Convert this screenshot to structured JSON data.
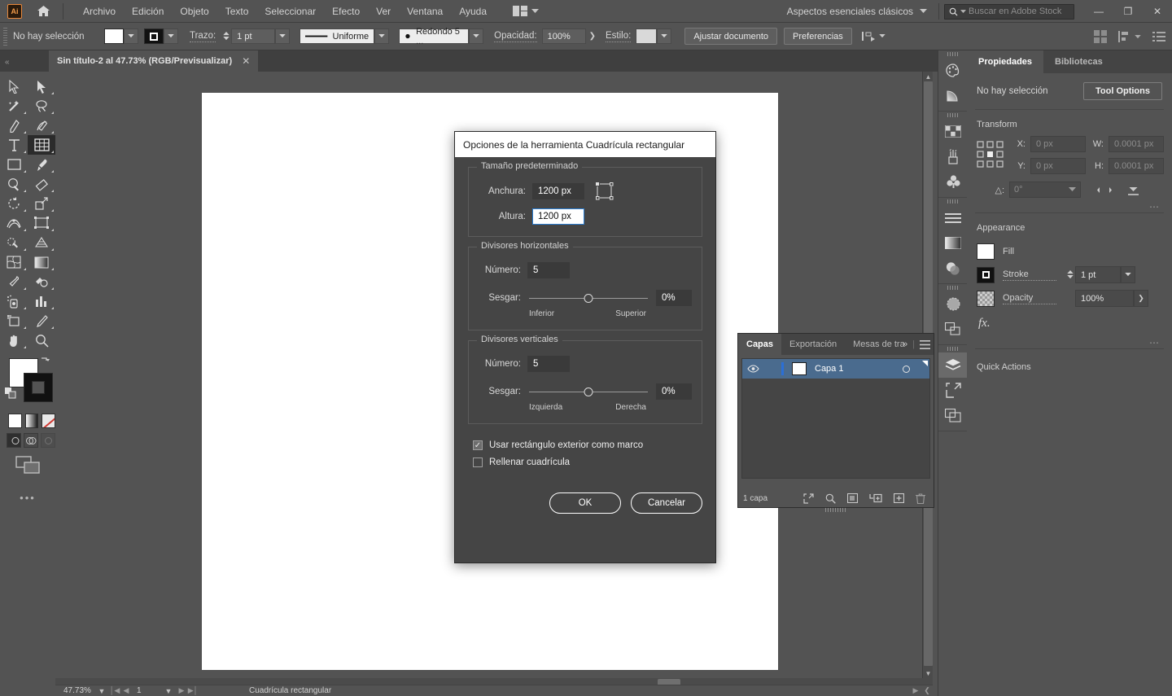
{
  "menubar": {
    "logo": "Ai",
    "home_icon": "home-icon",
    "items": [
      "Archivo",
      "Edición",
      "Objeto",
      "Texto",
      "Seleccionar",
      "Efecto",
      "Ver",
      "Ventana",
      "Ayuda"
    ],
    "arrange_icon": "arrange-documents-icon",
    "workspace": "Aspectos esenciales clásicos",
    "search_placeholder": "Buscar en Adobe Stock",
    "search_icon": "search-icon",
    "minimize": "—",
    "restore": "❐",
    "close": "✕"
  },
  "controlbar": {
    "selection_status": "No hay selección",
    "fill_label": "fill-swatch",
    "stroke_color_label": "stroke-swatch",
    "stroke_label": "Trazo:",
    "stroke_weight": "1 pt",
    "profile_label": "Uniforme",
    "brush_label": "Redondo 5 ...",
    "opacity_label": "Opacidad:",
    "opacity_value": "100%",
    "style_label": "Estilo:",
    "doc_setup_button": "Ajustar documento",
    "preferences_button": "Preferencias",
    "align_icon": "align-to-selection-icon"
  },
  "tabbar": {
    "document_title": "Sin título-2 al 47.73% (RGB/Previsualizar)",
    "close_icon": "✕"
  },
  "toolbar": {
    "tools": [
      {
        "name": "selection-tool",
        "glyph": "selection"
      },
      {
        "name": "direct-selection-tool",
        "glyph": "direct-selection"
      },
      {
        "name": "magic-wand-tool",
        "glyph": "wand"
      },
      {
        "name": "lasso-tool",
        "glyph": "lasso"
      },
      {
        "name": "pen-tool",
        "glyph": "pen"
      },
      {
        "name": "curvature-tool",
        "glyph": "curvature"
      },
      {
        "name": "type-tool",
        "glyph": "type"
      },
      {
        "name": "rectangular-grid-tool",
        "glyph": "grid",
        "active": true
      },
      {
        "name": "rectangle-tool",
        "glyph": "rect"
      },
      {
        "name": "paintbrush-tool",
        "glyph": "brush"
      },
      {
        "name": "shaper-tool",
        "glyph": "shaper"
      },
      {
        "name": "eraser-tool",
        "glyph": "eraser"
      },
      {
        "name": "rotate-tool",
        "glyph": "rotate"
      },
      {
        "name": "scale-tool",
        "glyph": "scale"
      },
      {
        "name": "width-tool",
        "glyph": "width"
      },
      {
        "name": "free-transform-tool",
        "glyph": "freetransform"
      },
      {
        "name": "shape-builder-tool",
        "glyph": "shapebuilder"
      },
      {
        "name": "perspective-grid-tool",
        "glyph": "perspective"
      },
      {
        "name": "mesh-tool",
        "glyph": "mesh"
      },
      {
        "name": "gradient-tool",
        "glyph": "gradient"
      },
      {
        "name": "eyedropper-tool",
        "glyph": "eyedropper"
      },
      {
        "name": "blend-tool",
        "glyph": "blend"
      },
      {
        "name": "symbol-sprayer-tool",
        "glyph": "symbolsprayer"
      },
      {
        "name": "column-graph-tool",
        "glyph": "graph"
      },
      {
        "name": "artboard-tool",
        "glyph": "artboard"
      },
      {
        "name": "slice-tool",
        "glyph": "slice"
      },
      {
        "name": "hand-tool",
        "glyph": "hand"
      },
      {
        "name": "zoom-tool",
        "glyph": "zoom"
      }
    ],
    "fill_color": "#ffffff",
    "stroke_color": "#000000",
    "swap_icon": "swap-fill-stroke-icon",
    "default_icon": "default-fill-stroke-icon",
    "modes": [
      "color-mode",
      "gradient-mode",
      "none-mode"
    ],
    "draw_modes": [
      "draw-normal",
      "draw-behind",
      "draw-inside"
    ],
    "screen_mode_icon": "change-screen-mode-icon",
    "more_dots": "•••"
  },
  "statusbar": {
    "zoom": "47.73%",
    "page": "1",
    "current_tool": "Cuadrícula rectangular"
  },
  "rail": {
    "groups": [
      [
        "color-panel-icon",
        "color-guide-icon"
      ],
      [
        "swatches-panel-icon",
        "brushes-panel-icon",
        "symbols-panel-icon"
      ],
      [
        "stroke-panel-icon",
        "gradient-panel-icon",
        "transparency-panel-icon"
      ],
      [
        "appearance-panel-icon",
        "pathfinder-panel-icon"
      ],
      [
        "layers-panel-icon",
        "asset-export-icon",
        "artboards-panel-icon"
      ]
    ]
  },
  "properties": {
    "tabs": [
      {
        "label": "Propiedades",
        "active": true
      },
      {
        "label": "Bibliotecas",
        "active": false
      }
    ],
    "selection_status": "No hay selección",
    "tool_options_button": "Tool Options",
    "transform": {
      "title": "Transform",
      "x_label": "X:",
      "x_value": "0 px",
      "y_label": "Y:",
      "y_value": "0 px",
      "w_label": "W:",
      "w_value": "0.0001 px",
      "h_label": "H:",
      "h_value": "0.0001 px",
      "angle_label": "△:",
      "angle_value": "0°",
      "link_icon": "constrain-proportions-icon",
      "flip_h_icon": "flip-horizontal-icon",
      "flip_v_icon": "flip-vertical-icon",
      "more_icon": "more-options-icon"
    },
    "appearance": {
      "title": "Appearance",
      "fill_label": "Fill",
      "stroke_label": "Stroke",
      "stroke_value": "1 pt",
      "opacity_label": "Opacity",
      "opacity_value": "100%",
      "fx_label": "fx.",
      "more_icon": "more-options-icon"
    },
    "quick_actions": {
      "title": "Quick Actions"
    }
  },
  "layers_panel": {
    "tabs": [
      {
        "label": "Capas",
        "active": true
      },
      {
        "label": "Exportación",
        "active": false
      },
      {
        "label": "Mesas de tra",
        "active": false
      }
    ],
    "collapse_icon": "»",
    "menu_icon": "panel-menu-icon",
    "rows": [
      {
        "name": "Capa 1",
        "visible": true,
        "selected": true
      }
    ],
    "footer_count": "1 capa",
    "footer_icons": [
      "locate-object-icon",
      "find-icon",
      "make-clipping-mask-icon",
      "create-sublayer-icon",
      "create-new-layer-icon",
      "delete-selection-icon"
    ]
  },
  "dialog": {
    "title": "Opciones de la herramienta Cuadrícula rectangular",
    "default_size": {
      "legend": "Tamaño predeterminado",
      "width_label": "Anchura:",
      "width_value": "1200 px",
      "height_label": "Altura:",
      "height_value": "1200 px",
      "ref_point_icon": "reference-point-icon"
    },
    "horizontal_dividers": {
      "legend": "Divisores horizontales",
      "number_label": "Número:",
      "number_value": "5",
      "skew_label": "Sesgar:",
      "skew_value": "0%",
      "skew_min_label": "Inferior",
      "skew_max_label": "Superior"
    },
    "vertical_dividers": {
      "legend": "Divisores verticales",
      "number_label": "Número:",
      "number_value": "5",
      "skew_label": "Sesgar:",
      "skew_value": "0%",
      "skew_min_label": "Izquierda",
      "skew_max_label": "Derecha"
    },
    "checkbox_outer_rect": {
      "label": "Usar rectángulo exterior como marco",
      "checked": true
    },
    "checkbox_fill_grid": {
      "label": "Rellenar cuadrícula",
      "checked": false
    },
    "ok_button": "OK",
    "cancel_button": "Cancelar"
  }
}
